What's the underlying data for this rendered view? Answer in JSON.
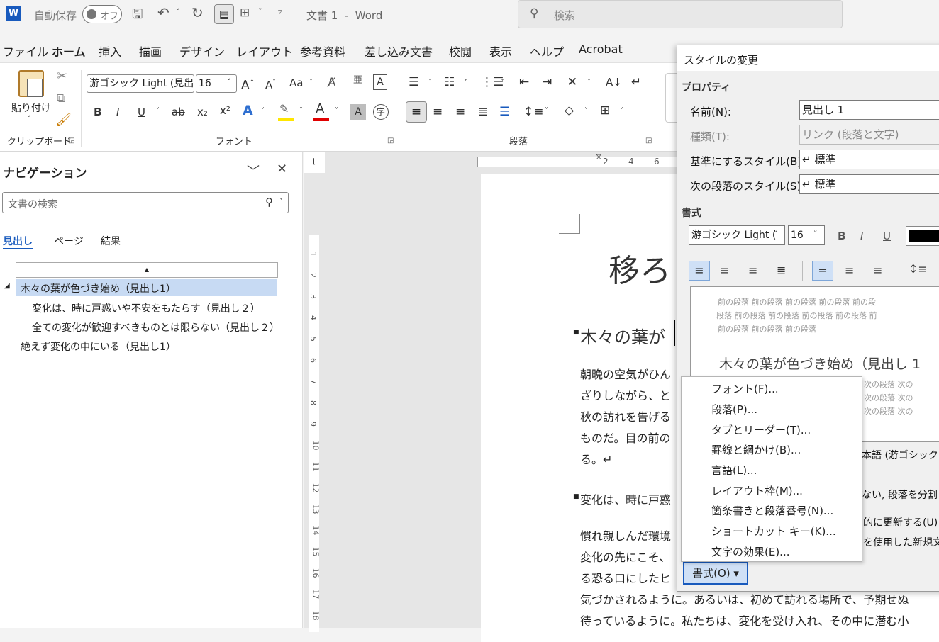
{
  "titlebar": {
    "app_icon": "W",
    "autosave_label": "自動保存",
    "autosave_state": "オフ",
    "doc_title": "文書 1  -  Word",
    "search_placeholder": "検索"
  },
  "menu": [
    "ファイル",
    "ホーム",
    "挿入",
    "描画",
    "デザイン",
    "レイアウト",
    "参考資料",
    "差し込み文書",
    "校閲",
    "表示",
    "ヘルプ",
    "Acrobat"
  ],
  "ribbon": {
    "paste_label": "貼り付け",
    "clipboard_group": "クリップボード",
    "font_name": "游ゴシック Light (見出",
    "font_size": "16",
    "font_group": "フォント",
    "paragraph_group": "段落",
    "bold": "B",
    "italic": "I",
    "underline": "U",
    "strike": "ab",
    "subscript": "x₂",
    "superscript": "x²",
    "grow_font": "A^",
    "shrink_font": "A˅",
    "change_case": "Aa",
    "colors": {
      "highlight": "#ffe600",
      "font_color": "#e00000",
      "accent": "#185abd"
    }
  },
  "nav": {
    "title": "ナビゲーション",
    "search_placeholder": "文書の検索",
    "tabs": [
      "見出し",
      "ページ",
      "結果"
    ],
    "headings": [
      {
        "text": "木々の葉が色づき始め（見出し1）",
        "level": 1,
        "selected": true
      },
      {
        "text": "変化は、時に戸惑いや不安をもたらす（見出し２）",
        "level": 2
      },
      {
        "text": "全ての変化が歓迎すべきものとは限らない（見出し２）",
        "level": 2
      },
      {
        "text": "絶えず変化の中にいる（見出し1）",
        "level": 1
      }
    ]
  },
  "ruler": {
    "h_ticks": [
      "2",
      "4",
      "6"
    ],
    "v_ticks": [
      "1",
      "2",
      "3",
      "4",
      "5",
      "6",
      "7",
      "8",
      "9",
      "10",
      "11",
      "12",
      "13",
      "14",
      "15",
      "16",
      "17",
      "18"
    ]
  },
  "document": {
    "title_fragment": "移ろ",
    "heading1": "木々の葉が",
    "para1_lines": [
      "朝晩の空気がひん",
      "ざりしながら、と",
      "秋の訪れを告げる",
      "ものだ。目の前の",
      "る。↵"
    ],
    "heading2": "変化は、時に戸惑",
    "para2_lines": [
      "慣れ親しんだ環境",
      "変化の先にこそ、",
      "る恐る口にしたヒ",
      "気づかされるように。あるいは、初めて訪れる場所で、予期せぬ",
      "待っているように。私たちは、変化を受け入れ、その中に潜む小"
    ]
  },
  "dialog": {
    "title": "スタイルの変更",
    "properties_label": "プロパティ",
    "name_label": "名前(N):",
    "name_value": "見出し 1",
    "type_label": "種類(T):",
    "type_value": "リンク (段落と文字)",
    "base_label": "基準にするスタイル(B):",
    "base_value": "↵ 標準",
    "next_label": "次の段落のスタイル(S):",
    "next_value": "↵ 標準",
    "format_label": "書式",
    "font_value": "游ゴシック Light (",
    "size_value": "16",
    "bold": "B",
    "italic": "I",
    "underline": "U",
    "preview_prev_lines": [
      "前の段落 前の段落 前の段落 前の段落 前の段",
      "段落 前の段落 前の段落 前の段落 前の段落 前",
      "前の段落 前の段落 前の段落"
    ],
    "preview_heading": "木々の葉が色づき始め（見出し 1",
    "preview_next_lines": [
      "次の段落 次の",
      "次の段落 次の",
      "次の段落 次の"
    ],
    "desc_fragment": "本語 (游ゴシック Lig",
    "desc2_fragment": "ない, 段落を分割し",
    "auto_update": "的に更新する(U)",
    "new_doc": "を使用した新規文書",
    "format_button": "書式(O) ▾"
  },
  "context_menu": [
    "フォント(F)...",
    "段落(P)...",
    "タブとリーダー(T)...",
    "罫線と網かけ(B)...",
    "言語(L)...",
    "レイアウト枠(M)...",
    "箇条書きと段落番号(N)...",
    "ショートカット キー(K)...",
    "文字の効果(E)..."
  ]
}
